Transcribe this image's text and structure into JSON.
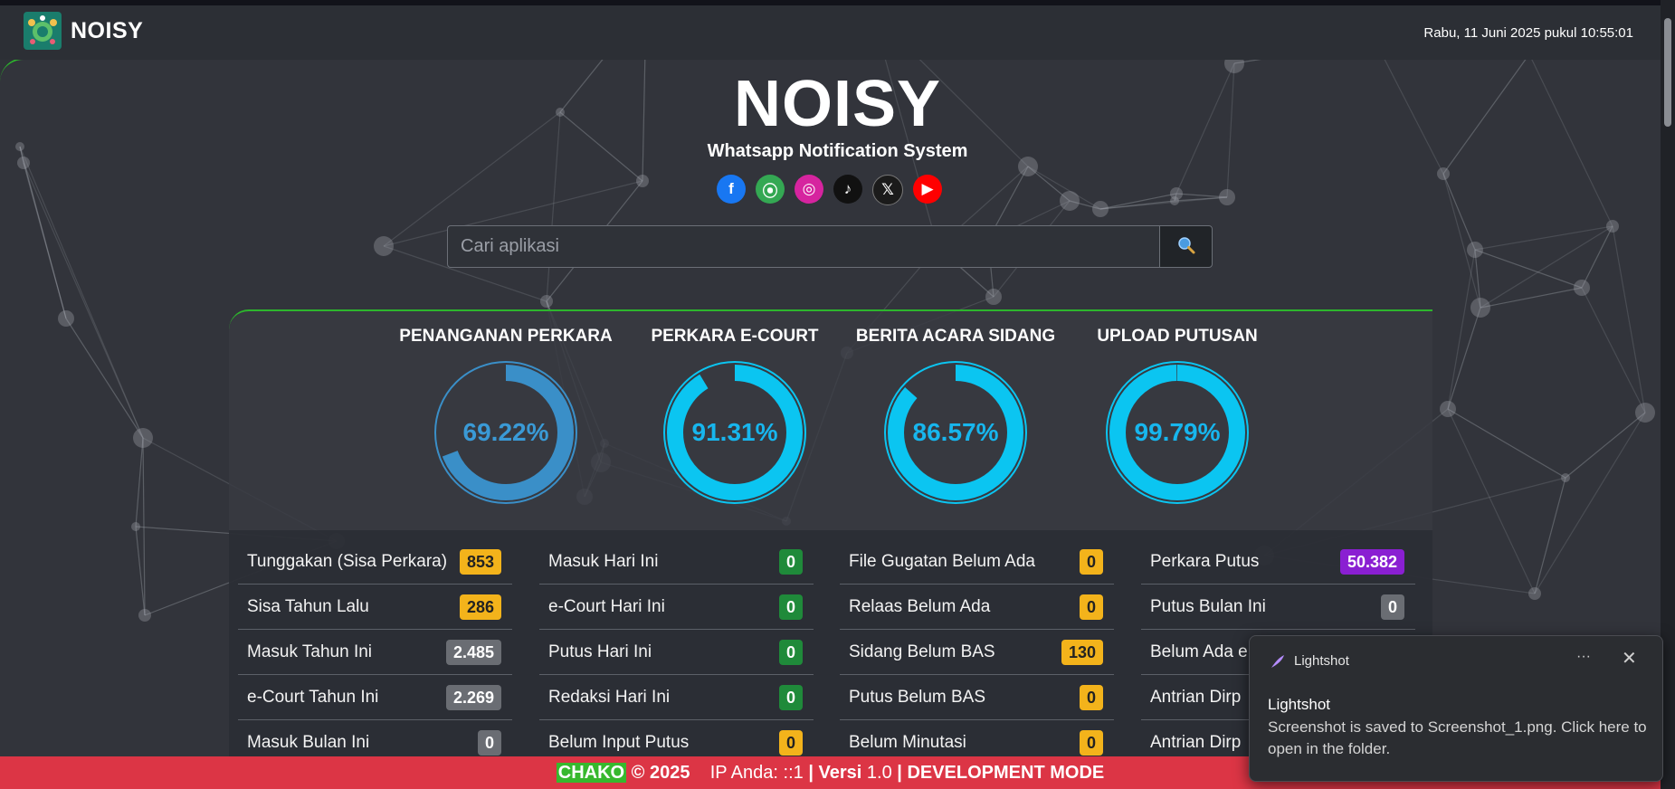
{
  "topbar": {
    "brand": "NOISY",
    "datetime": "Rabu, 11 Juni 2025 pukul 10:55:01"
  },
  "hero": {
    "title": "NOISY",
    "subtitle": "Whatsapp Notification System"
  },
  "socials": [
    {
      "icon": "facebook-icon",
      "glyph": "f",
      "color": "#1877f2"
    },
    {
      "icon": "google-maps-icon",
      "glyph": "⦿",
      "color": "#34a853"
    },
    {
      "icon": "instagram-icon",
      "glyph": "◎",
      "color": "#d6249f"
    },
    {
      "icon": "tiktok-icon",
      "glyph": "♪",
      "color": "#111111"
    },
    {
      "icon": "x-icon",
      "glyph": "𝕏",
      "color": "#1b1b1b"
    },
    {
      "icon": "youtube-icon",
      "glyph": "▶",
      "color": "#ff0000"
    }
  ],
  "search": {
    "placeholder": "Cari aplikasi",
    "button_icon": "search-icon"
  },
  "gauges": [
    {
      "label": "PENANGANAN PERKARA",
      "value": "69.22%",
      "fraction": 0.6922,
      "color": "#3a8fc8",
      "text_color": "#3a9ad6"
    },
    {
      "label": "PERKARA E-COURT",
      "value": "91.31%",
      "fraction": 0.9131,
      "color": "#0bc5f1",
      "text_color": "#17b6ee"
    },
    {
      "label": "BERITA ACARA SIDANG",
      "value": "86.57%",
      "fraction": 0.8657,
      "color": "#0bc5f1",
      "text_color": "#17b6ee"
    },
    {
      "label": "UPLOAD PUTUSAN",
      "value": "99.79%",
      "fraction": 0.9979,
      "color": "#0bc5f1",
      "text_color": "#17b6ee"
    }
  ],
  "stats": {
    "col1": [
      {
        "label": "Tunggakan (Sisa Perkara)",
        "value": "853",
        "style": "yellow"
      },
      {
        "label": "Sisa Tahun Lalu",
        "value": "286",
        "style": "yellow"
      },
      {
        "label": "Masuk Tahun Ini",
        "value": "2.485",
        "style": "gray"
      },
      {
        "label": "e-Court Tahun Ini",
        "value": "2.269",
        "style": "gray"
      },
      {
        "label": "Masuk Bulan Ini",
        "value": "0",
        "style": "gray"
      }
    ],
    "col2": [
      {
        "label": "Masuk Hari Ini",
        "value": "0",
        "style": "green"
      },
      {
        "label": "e-Court Hari Ini",
        "value": "0",
        "style": "green"
      },
      {
        "label": "Putus Hari Ini",
        "value": "0",
        "style": "green"
      },
      {
        "label": "Redaksi Hari Ini",
        "value": "0",
        "style": "green"
      },
      {
        "label": "Belum Input Putus",
        "value": "0",
        "style": "yellow"
      }
    ],
    "col3": [
      {
        "label": "File Gugatan Belum Ada",
        "value": "0",
        "style": "yellow"
      },
      {
        "label": "Relaas Belum Ada",
        "value": "0",
        "style": "yellow"
      },
      {
        "label": "Sidang Belum BAS",
        "value": "130",
        "style": "yellow"
      },
      {
        "label": "Putus Belum BAS",
        "value": "0",
        "style": "yellow"
      },
      {
        "label": "Belum Minutasi",
        "value": "0",
        "style": "yellow"
      }
    ],
    "col4": [
      {
        "label": "Perkara Putus",
        "value": "50.382",
        "style": "purple"
      },
      {
        "label": "Putus Bulan Ini",
        "value": "0",
        "style": "gray"
      },
      {
        "label": "Belum Ada e",
        "value": "",
        "style": "none"
      },
      {
        "label": "Antrian Dirp",
        "value": "",
        "style": "none"
      },
      {
        "label": "Antrian Dirp",
        "value": "",
        "style": "none"
      }
    ]
  },
  "footer": {
    "chako": "CHAKO",
    "copyright": "© 2025",
    "ip_label": "IP Anda:",
    "ip_value": "::1",
    "sep": "|",
    "versi_label": "Versi",
    "versi_value": "1.0",
    "mode": "DEVELOPMENT MODE"
  },
  "toast": {
    "app": "Lightshot",
    "more": "···",
    "close": "✕",
    "title": "Lightshot",
    "body": "Screenshot is saved to Screenshot_1.png. Click here to open in the folder."
  }
}
